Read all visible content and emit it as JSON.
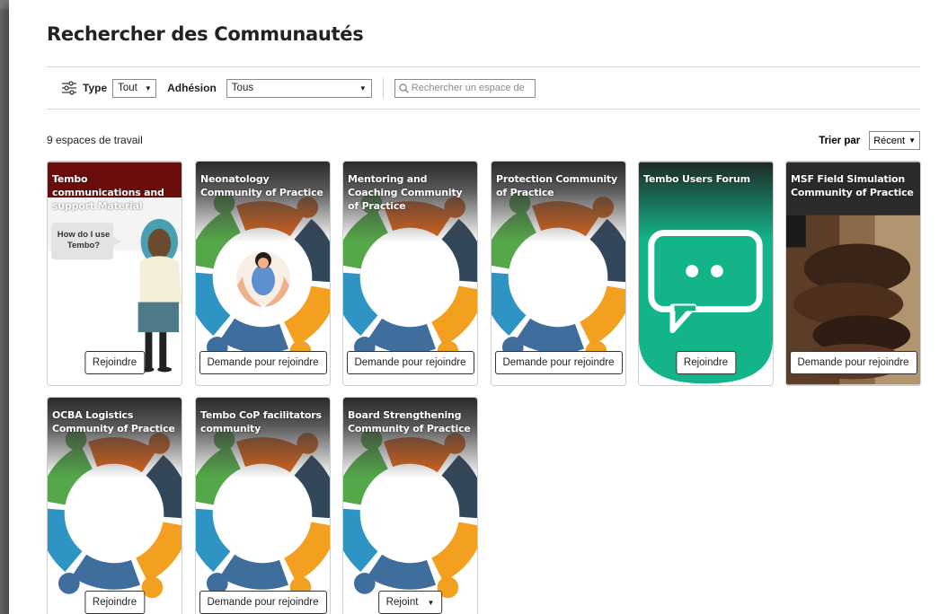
{
  "page_title": "Rechercher des Communautés",
  "filters": {
    "type_label": "Type",
    "type_value": "Tout",
    "membership_label": "Adhésion",
    "membership_value": "Tous",
    "search_placeholder": "Rechercher un espace de"
  },
  "result_count": "9 espaces de travail",
  "sort": {
    "label": "Trier par",
    "value": "Récent"
  },
  "cards": [
    {
      "title": "Tembo communications and support Material",
      "button": "Rejoindre",
      "bubble": "How do I use Tembo?"
    },
    {
      "title": "Neonatology Community of Practice",
      "button": "Demande pour rejoindre"
    },
    {
      "title": "Mentoring and Coaching Community of Practice",
      "button": "Demande pour rejoindre"
    },
    {
      "title": "Protection Community of Practice",
      "button": "Demande pour rejoindre"
    },
    {
      "title": "Tembo Users Forum",
      "button": "Rejoindre"
    },
    {
      "title": "MSF Field Simulation Community of Practice",
      "button": "Demande pour rejoindre"
    },
    {
      "title": "OCBA Logistics Community of Practice",
      "button": "Rejoindre"
    },
    {
      "title": "Tembo CoP facilitators community",
      "button": "Demande pour rejoindre"
    },
    {
      "title": "Board Strengthening Community of Practice",
      "button": "Rejoint"
    }
  ],
  "colors": {
    "ring_orange": "#d9641e",
    "ring_navy": "#33475b",
    "ring_green": "#55a84a",
    "ring_yellow": "#f3a020",
    "ring_blue": "#2d94c4",
    "ring_slate": "#3f6e9c",
    "forum_green": "#13b48a",
    "tembo_red": "#6b0d0d"
  }
}
